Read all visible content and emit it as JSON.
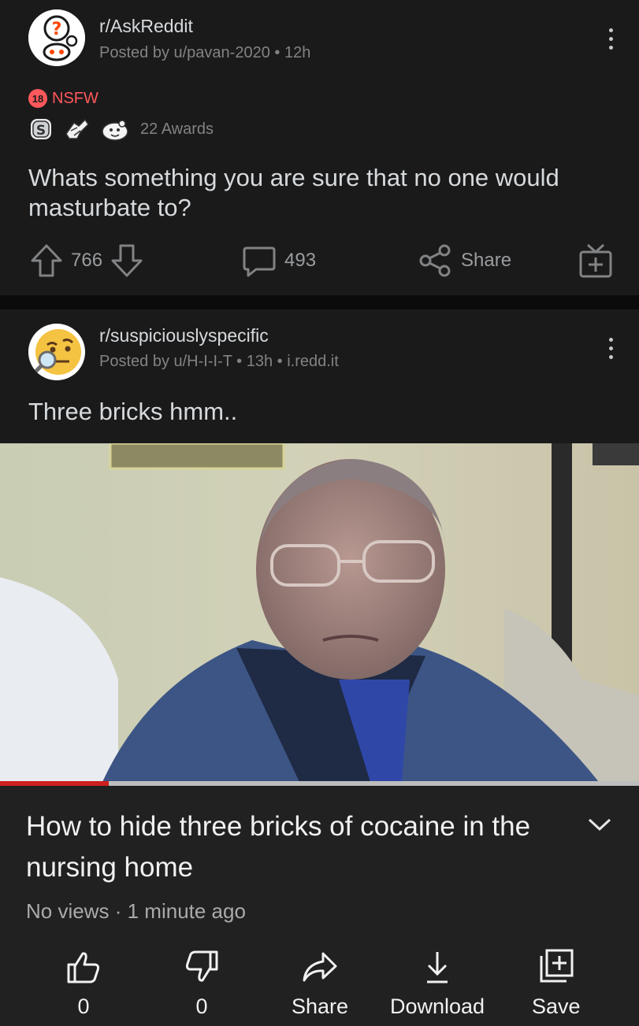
{
  "post1": {
    "subreddit": "r/AskReddit",
    "posted_by": "Posted by u/pavan-2020",
    "age": "12h",
    "nsfw_badge": "18",
    "nsfw_label": "NSFW",
    "awards": "22 Awards",
    "title": "Whats something you are sure that no one would masturbate to?",
    "upvotes": "766",
    "comments": "493",
    "share_label": "Share"
  },
  "post2": {
    "subreddit": "r/suspiciouslyspecific",
    "posted_by": "Posted by u/H-I-I-T",
    "age": "13h",
    "domain": "i.redd.it",
    "title": "Three bricks hmm..",
    "embedded_video": {
      "title": "How to hide three bricks of cocaine in the nursing home",
      "views": "No views",
      "age": "1 minute ago",
      "progress_percent": 17,
      "likes": "0",
      "dislikes": "0",
      "share_label": "Share",
      "download_label": "Download",
      "save_label": "Save"
    }
  },
  "colors": {
    "background": "#1a1a1b",
    "nsfw": "#ff585b",
    "progress": "#cc1f1f",
    "meta": "#818384"
  },
  "icons": [
    "askreddit-avatar-icon",
    "kebab-menu-icon",
    "nsfw-badge-icon",
    "silver-award-icon",
    "helpful-award-icon",
    "wholesome-award-icon",
    "upvote-icon",
    "downvote-icon",
    "comment-icon",
    "share-icon",
    "gift-award-icon",
    "suspicious-face-avatar-icon",
    "thumbs-up-icon",
    "thumbs-down-icon",
    "share-arrow-icon",
    "download-icon",
    "save-playlist-icon",
    "chevron-down-icon"
  ]
}
